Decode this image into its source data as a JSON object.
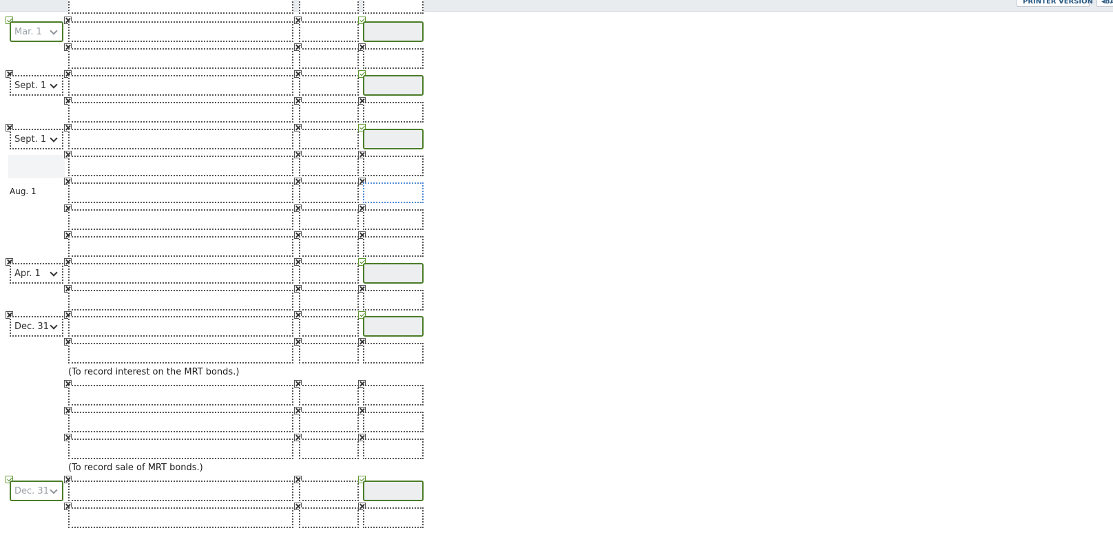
{
  "toolbar": {
    "printer_version_label": "PRINTER VERSION",
    "back_label": "BACK"
  },
  "colors": {
    "correct": "#4a7d28",
    "focus": "#4f8bd6",
    "topbar": "#e9ecef"
  },
  "icons": {
    "incorrect": "x-mark-icon",
    "correct": "checkmark-icon",
    "dropdown": "chevron-down-icon"
  },
  "journal": {
    "top_partial_row": true,
    "rows": [
      {
        "kind": "entry",
        "date": {
          "type": "select",
          "value": "Mar. 1",
          "status": "correct"
        },
        "acct_mark": "x",
        "debit_mark": "x",
        "credit_mark": "ok",
        "credit_state": "correct"
      },
      {
        "kind": "entry",
        "date": {
          "type": "none"
        },
        "acct_mark": "x",
        "debit_mark": "x",
        "credit_mark": "x",
        "credit_state": "empty"
      },
      {
        "kind": "entry",
        "date": {
          "type": "select",
          "value": "Sept. 1",
          "status": "incorrect"
        },
        "acct_mark": "x",
        "debit_mark": "x",
        "credit_mark": "ok",
        "credit_state": "correct"
      },
      {
        "kind": "entry",
        "date": {
          "type": "none"
        },
        "acct_mark": "x",
        "debit_mark": "x",
        "credit_mark": "x",
        "credit_state": "empty"
      },
      {
        "kind": "entry",
        "date": {
          "type": "select",
          "value": "Sept. 1",
          "status": "incorrect"
        },
        "acct_mark": "x",
        "debit_mark": "x",
        "credit_mark": "ok",
        "credit_state": "correct"
      },
      {
        "kind": "entry",
        "date": {
          "type": "blank"
        },
        "acct_mark": "x",
        "debit_mark": "x",
        "credit_mark": "x",
        "credit_state": "empty"
      },
      {
        "kind": "entry",
        "date": {
          "type": "static",
          "value": "Aug. 1"
        },
        "acct_mark": "x",
        "debit_mark": "x",
        "credit_mark": "x",
        "credit_state": "focused"
      },
      {
        "kind": "entry",
        "date": {
          "type": "none"
        },
        "acct_mark": "x",
        "debit_mark": "x",
        "credit_mark": "x",
        "credit_state": "empty"
      },
      {
        "kind": "entry",
        "date": {
          "type": "none"
        },
        "acct_mark": "x",
        "debit_mark": "x",
        "credit_mark": "x",
        "credit_state": "empty"
      },
      {
        "kind": "entry",
        "date": {
          "type": "select",
          "value": "Apr. 1",
          "status": "incorrect"
        },
        "acct_mark": "x",
        "debit_mark": "x",
        "credit_mark": "ok",
        "credit_state": "correct"
      },
      {
        "kind": "entry",
        "date": {
          "type": "none"
        },
        "acct_mark": "x",
        "debit_mark": "x",
        "credit_mark": "x",
        "credit_state": "empty"
      },
      {
        "kind": "entry",
        "date": {
          "type": "select",
          "value": "Dec. 31",
          "status": "incorrect"
        },
        "acct_mark": "x",
        "debit_mark": "x",
        "credit_mark": "ok",
        "credit_state": "correct"
      },
      {
        "kind": "entry",
        "date": {
          "type": "none"
        },
        "acct_mark": "x",
        "debit_mark": "x",
        "credit_mark": "x",
        "credit_state": "empty"
      },
      {
        "kind": "note",
        "text": "(To record interest on the MRT bonds.)"
      },
      {
        "kind": "entry",
        "date": {
          "type": "none"
        },
        "acct_mark": "x",
        "debit_mark": "x",
        "credit_mark": "x",
        "credit_state": "empty"
      },
      {
        "kind": "entry",
        "date": {
          "type": "none"
        },
        "acct_mark": "x",
        "debit_mark": "x",
        "credit_mark": "x",
        "credit_state": "empty"
      },
      {
        "kind": "entry",
        "date": {
          "type": "none"
        },
        "acct_mark": "x",
        "debit_mark": "x",
        "credit_mark": "x",
        "credit_state": "empty"
      },
      {
        "kind": "note",
        "text": "(To record sale of MRT bonds.)"
      },
      {
        "kind": "entry",
        "date": {
          "type": "select",
          "value": "Dec. 31",
          "status": "correct"
        },
        "acct_mark": "x",
        "debit_mark": "x",
        "credit_mark": "ok",
        "credit_state": "correct"
      },
      {
        "kind": "entry",
        "date": {
          "type": "none"
        },
        "acct_mark": "x",
        "debit_mark": "x",
        "credit_mark": "x",
        "credit_state": "empty"
      }
    ]
  }
}
